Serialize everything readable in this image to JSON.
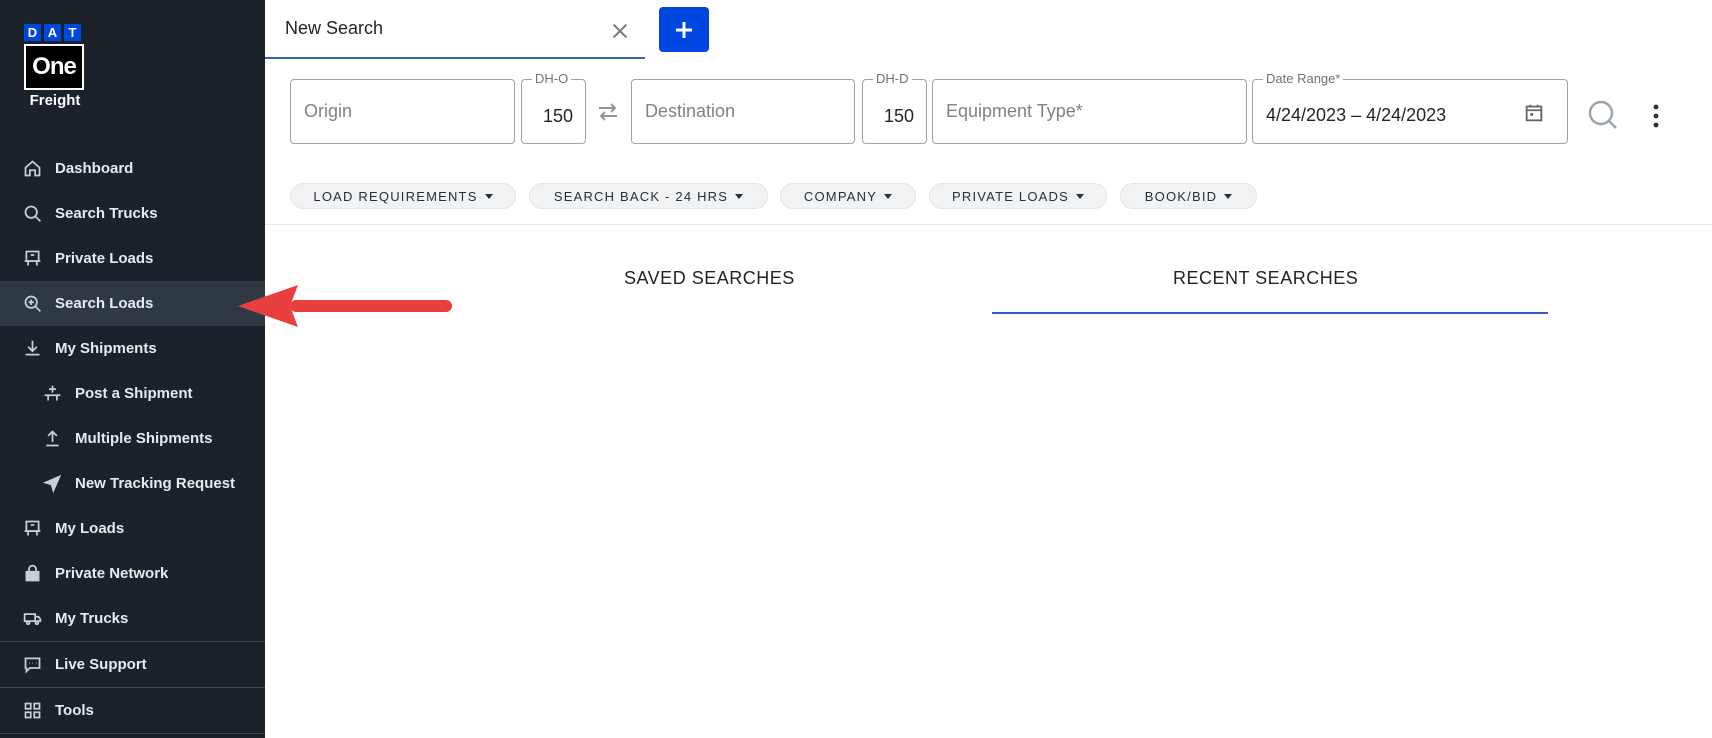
{
  "logo": {
    "letters": [
      "D",
      "A",
      "T"
    ],
    "one": "One",
    "freight": "Freight"
  },
  "sidebar": {
    "items": [
      {
        "label": "Dashboard",
        "icon": "home-icon"
      },
      {
        "label": "Search Trucks",
        "icon": "search-icon"
      },
      {
        "label": "Private Loads",
        "icon": "load-board-icon"
      },
      {
        "label": "Search Loads",
        "icon": "search-plus-icon",
        "active": true
      },
      {
        "label": "My Shipments",
        "icon": "download-icon"
      },
      {
        "label": "Post a Shipment",
        "icon": "post-icon"
      },
      {
        "label": "Multiple Shipments",
        "icon": "upload-icon"
      },
      {
        "label": "New Tracking Request",
        "icon": "navigation-arrow-icon"
      },
      {
        "label": "My Loads",
        "icon": "load-board-icon"
      },
      {
        "label": "Private Network",
        "icon": "lock-icon"
      },
      {
        "label": "My Trucks",
        "icon": "truck-icon"
      },
      {
        "label": "Live Support",
        "icon": "chat-icon"
      },
      {
        "label": "Tools",
        "icon": "grid-icon"
      }
    ]
  },
  "tabs": {
    "active_title": "New Search"
  },
  "search": {
    "origin_placeholder": "Origin",
    "dh_o_label": "DH-O",
    "dh_o_value": "150",
    "destination_placeholder": "Destination",
    "dh_d_label": "DH-D",
    "dh_d_value": "150",
    "equipment_placeholder": "Equipment Type*",
    "date_label": "Date Range*",
    "date_value": "4/24/2023 – 4/24/2023"
  },
  "filters": {
    "load_requirements": "LOAD REQUIREMENTS",
    "search_back": "SEARCH BACK - 24 HRS",
    "company": "COMPANY",
    "private_loads": "PRIVATE LOADS",
    "book_bid": "BOOK/BID"
  },
  "search_tabs": {
    "saved": "SAVED SEARCHES",
    "recent": "RECENT SEARCHES",
    "active": "recent"
  },
  "colors": {
    "sidebar_bg": "#1b222a",
    "active_item_bg": "#2e3943",
    "brand_blue": "#0046e0",
    "annotation_arrow": "#e8403f"
  }
}
